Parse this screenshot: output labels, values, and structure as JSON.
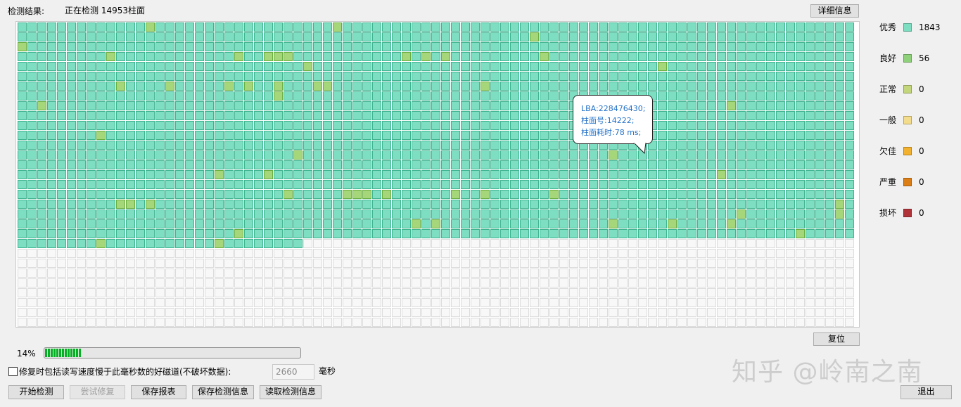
{
  "header": {
    "result_label": "检测结果:",
    "status_text": "正在检测 14953柱面",
    "detail_button": "详细信息"
  },
  "legend": [
    {
      "name": "优秀",
      "color": "#7ddec2",
      "count": "1843"
    },
    {
      "name": "良好",
      "color": "#8fd07b",
      "count": "56"
    },
    {
      "name": "正常",
      "color": "#c3d67b",
      "count": "0"
    },
    {
      "name": "一般",
      "color": "#f3dc8c",
      "count": "0"
    },
    {
      "name": "欠佳",
      "color": "#f2b12e",
      "count": "0"
    },
    {
      "name": "严重",
      "color": "#dc7e16",
      "count": "0"
    },
    {
      "name": "损坏",
      "color": "#b0333a",
      "count": "0"
    }
  ],
  "tooltip": {
    "lba": "LBA:228476430;",
    "cylinder": "柱面号:14222;",
    "time": "柱面耗时:78 ms;"
  },
  "reset_button": "复位",
  "progress": {
    "percent_text": "14%",
    "fraction": 0.14
  },
  "repair_option": {
    "checked": false,
    "label": "修复时包括读写速度慢于此毫秒数的好磁道(不破坏数据):",
    "value": "2660",
    "unit": "毫秒"
  },
  "buttons": {
    "start": "开始检测",
    "repair": "尝试修复",
    "save_report": "保存报表",
    "save_info": "保存检测信息",
    "load_info": "读取检测信息",
    "exit": "退出"
  },
  "watermark": "知乎 @岭南之南"
}
